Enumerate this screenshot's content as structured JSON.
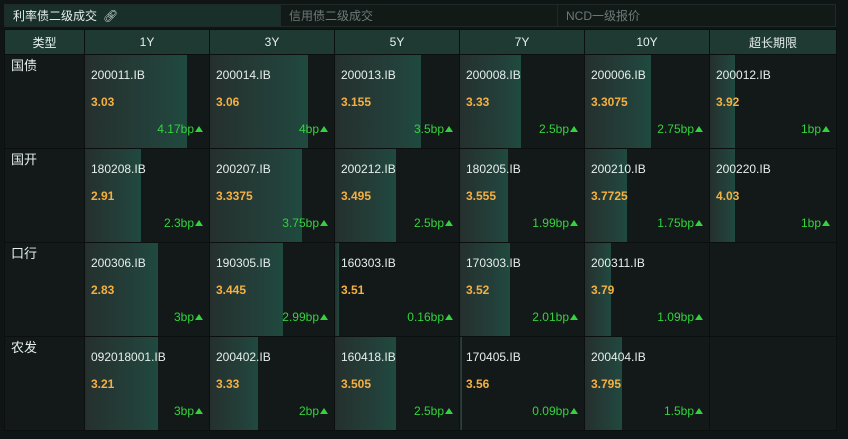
{
  "tabs": [
    {
      "label": "利率债二级成交",
      "active": true
    },
    {
      "label": "信用债二级成交",
      "active": false
    },
    {
      "label": "NCD一级报价",
      "active": false
    }
  ],
  "columns": [
    "类型",
    "1Y",
    "3Y",
    "5Y",
    "7Y",
    "10Y",
    "超长期限"
  ],
  "colors": {
    "yield": "#f5b041",
    "change_up": "#35d23f",
    "header_bg": "#1e3a33"
  },
  "rows": [
    {
      "type": "国债",
      "cells": [
        {
          "code": "200011.IB",
          "yield": "3.03",
          "change": "4.17bp",
          "dir": "up",
          "fill": 0.82
        },
        {
          "code": "200014.IB",
          "yield": "3.06",
          "change": "4bp",
          "dir": "up",
          "fill": 0.79
        },
        {
          "code": "200013.IB",
          "yield": "3.155",
          "change": "3.5bp",
          "dir": "up",
          "fill": 0.69
        },
        {
          "code": "200008.IB",
          "yield": "3.33",
          "change": "2.5bp",
          "dir": "up",
          "fill": 0.49
        },
        {
          "code": "200006.IB",
          "yield": "3.3075",
          "change": "2.75bp",
          "dir": "up",
          "fill": 0.53
        },
        {
          "code": "200012.IB",
          "yield": "3.92",
          "change": "1bp",
          "dir": "up",
          "fill": 0.2
        }
      ]
    },
    {
      "type": "国开",
      "cells": [
        {
          "code": "180208.IB",
          "yield": "2.91",
          "change": "2.3bp",
          "dir": "up",
          "fill": 0.45
        },
        {
          "code": "200207.IB",
          "yield": "3.3375",
          "change": "3.75bp",
          "dir": "up",
          "fill": 0.74
        },
        {
          "code": "200212.IB",
          "yield": "3.495",
          "change": "2.5bp",
          "dir": "up",
          "fill": 0.49
        },
        {
          "code": "180205.IB",
          "yield": "3.555",
          "change": "1.99bp",
          "dir": "up",
          "fill": 0.39
        },
        {
          "code": "200210.IB",
          "yield": "3.7725",
          "change": "1.75bp",
          "dir": "up",
          "fill": 0.34
        },
        {
          "code": "200220.IB",
          "yield": "4.03",
          "change": "1bp",
          "dir": "up",
          "fill": 0.2
        }
      ]
    },
    {
      "type": "口行",
      "cells": [
        {
          "code": "200306.IB",
          "yield": "2.83",
          "change": "3bp",
          "dir": "up",
          "fill": 0.59
        },
        {
          "code": "190305.IB",
          "yield": "3.445",
          "change": "2.99bp",
          "dir": "up",
          "fill": 0.59
        },
        {
          "code": "160303.IB",
          "yield": "3.51",
          "change": "0.16bp",
          "dir": "up",
          "fill": 0.03
        },
        {
          "code": "170303.IB",
          "yield": "3.52",
          "change": "2.01bp",
          "dir": "up",
          "fill": 0.4
        },
        {
          "code": "200311.IB",
          "yield": "3.79",
          "change": "1.09bp",
          "dir": "up",
          "fill": 0.21
        },
        null
      ]
    },
    {
      "type": "农发",
      "cells": [
        {
          "code": "092018001.IB",
          "yield": "3.21",
          "change": "3bp",
          "dir": "up",
          "fill": 0.59
        },
        {
          "code": "200402.IB",
          "yield": "3.33",
          "change": "2bp",
          "dir": "up",
          "fill": 0.39
        },
        {
          "code": "160418.IB",
          "yield": "3.505",
          "change": "2.5bp",
          "dir": "up",
          "fill": 0.49
        },
        {
          "code": "170405.IB",
          "yield": "3.56",
          "change": "0.09bp",
          "dir": "up",
          "fill": 0.02
        },
        {
          "code": "200404.IB",
          "yield": "3.795",
          "change": "1.5bp",
          "dir": "up",
          "fill": 0.3
        },
        null
      ]
    }
  ]
}
